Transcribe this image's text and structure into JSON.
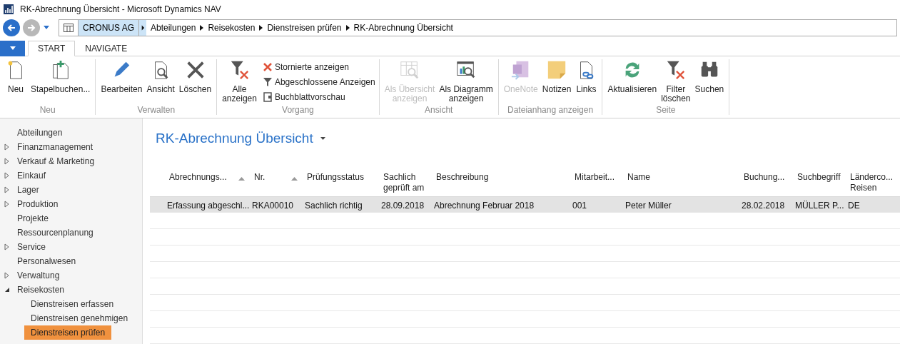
{
  "window": {
    "title": "RK-Abrechnung Übersicht - Microsoft Dynamics NAV"
  },
  "address_bar": {
    "company": "CRONUS AG",
    "breadcrumbs": [
      "Abteilungen",
      "Reisekosten",
      "Dienstreisen prüfen",
      "RK-Abrechnung Übersicht"
    ]
  },
  "tabs": [
    {
      "label": "START",
      "selected": true
    },
    {
      "label": "NAVIGATE",
      "selected": false
    }
  ],
  "ribbon": [
    {
      "label": "Neu",
      "items": [
        {
          "kind": "large",
          "label": "Neu",
          "disabled": false
        },
        {
          "kind": "large",
          "label": "Stapelbuchen...",
          "disabled": false
        }
      ]
    },
    {
      "label": "Verwalten",
      "items": [
        {
          "kind": "large",
          "label": "Bearbeiten",
          "disabled": false
        },
        {
          "kind": "large",
          "label": "Ansicht",
          "disabled": false
        },
        {
          "kind": "large",
          "label": "Löschen",
          "disabled": false
        }
      ]
    },
    {
      "label": "Vorgang",
      "items": [
        {
          "kind": "large",
          "label": "Alle\nanzeigen",
          "disabled": false
        },
        {
          "kind": "small",
          "label": "Stornierte anzeigen",
          "disabled": false
        },
        {
          "kind": "small",
          "label": "Abgeschlossene Anzeigen",
          "disabled": false
        },
        {
          "kind": "small",
          "label": "Buchblattvorschau",
          "disabled": false
        }
      ]
    },
    {
      "label": "Ansicht",
      "items": [
        {
          "kind": "large",
          "label": "Als Übersicht\nanzeigen",
          "disabled": true
        },
        {
          "kind": "large",
          "label": "Als Diagramm\nanzeigen",
          "disabled": false
        }
      ]
    },
    {
      "label": "Dateianhang anzeigen",
      "items": [
        {
          "kind": "large",
          "label": "OneNote",
          "disabled": true
        },
        {
          "kind": "large",
          "label": "Notizen",
          "disabled": false
        },
        {
          "kind": "large",
          "label": "Links",
          "disabled": false
        }
      ]
    },
    {
      "label": "Seite",
      "items": [
        {
          "kind": "large",
          "label": "Aktualisieren",
          "disabled": false
        },
        {
          "kind": "large",
          "label": "Filter\nlöschen",
          "disabled": false
        },
        {
          "kind": "large",
          "label": "Suchen",
          "disabled": false
        }
      ]
    }
  ],
  "sidebar": {
    "items": [
      {
        "label": "Abteilungen",
        "selected": false
      },
      {
        "label": "Finanzmanagement",
        "expanded": false,
        "selected": false
      },
      {
        "label": "Verkauf & Marketing",
        "expanded": false,
        "selected": false
      },
      {
        "label": "Einkauf",
        "expanded": false,
        "selected": false
      },
      {
        "label": "Lager",
        "expanded": false,
        "selected": false
      },
      {
        "label": "Produktion",
        "expanded": false,
        "selected": false
      },
      {
        "label": "Projekte",
        "selected": false
      },
      {
        "label": "Ressourcenplanung",
        "selected": false
      },
      {
        "label": "Service",
        "expanded": false,
        "selected": false
      },
      {
        "label": "Personalwesen",
        "selected": false
      },
      {
        "label": "Verwaltung",
        "expanded": false,
        "selected": false
      },
      {
        "label": "Reisekosten",
        "expanded": true,
        "selected": false,
        "children": [
          {
            "label": "Dienstreisen erfassen",
            "selected": false
          },
          {
            "label": "Dienstreisen genehmigen",
            "selected": false
          },
          {
            "label": "Dienstreisen prüfen",
            "selected": true
          }
        ]
      }
    ]
  },
  "page": {
    "title": "RK-Abrechnung Übersicht"
  },
  "table": {
    "columns": [
      {
        "label": "Abrechnungs...",
        "sorted": true
      },
      {
        "label": "Nr.",
        "sorted": true
      },
      {
        "label": "Prüfungsstatus",
        "sorted": false
      },
      {
        "label": "Sachlich\ngeprüft am",
        "sorted": false
      },
      {
        "label": "Beschreibung",
        "sorted": false
      },
      {
        "label": "Mitarbeit...",
        "sorted": false
      },
      {
        "label": "Name",
        "sorted": false
      },
      {
        "label": "Buchung...",
        "sorted": false
      },
      {
        "label": "Suchbegriff",
        "sorted": false
      },
      {
        "label": "Länderco...\nReisen",
        "sorted": false
      }
    ],
    "rows": [
      {
        "selected": true,
        "cells": [
          "Erfassung abgeschl...",
          "RKA00010",
          "Sachlich richtig",
          "28.09.2018",
          "Abrechnung Februar 2018",
          "001",
          "Peter Müller",
          "28.02.2018",
          "MÜLLER P...",
          "DE"
        ]
      }
    ]
  }
}
